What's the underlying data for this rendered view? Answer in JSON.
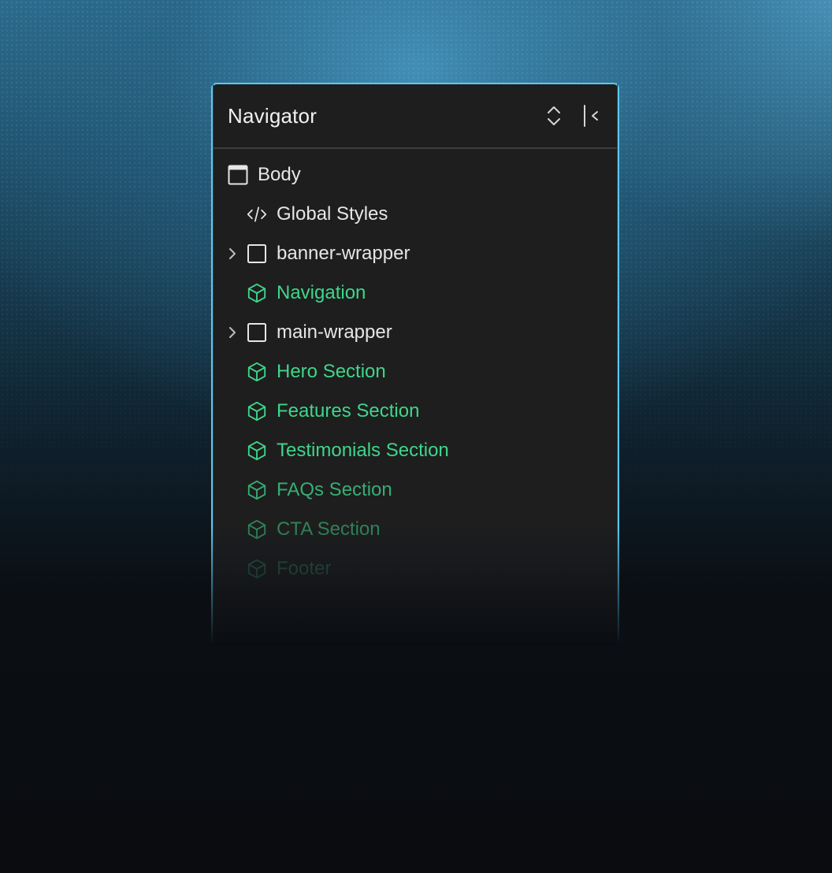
{
  "navigator": {
    "title": "Navigator"
  },
  "tree": {
    "items": [
      {
        "label": "Body",
        "icon": "body-frame-icon",
        "color": "#e6e6e6"
      },
      {
        "label": "Global Styles",
        "icon": "code-icon",
        "color": "#e6e6e6"
      },
      {
        "label": "banner-wrapper",
        "icon": "box-outline-icon",
        "color": "#e6e6e6",
        "expandable": true
      },
      {
        "label": "Navigation",
        "icon": "component-cube-icon",
        "color": "#3fd68a"
      },
      {
        "label": "main-wrapper",
        "icon": "box-outline-icon",
        "color": "#e6e6e6",
        "expandable": true
      },
      {
        "label": "Hero Section",
        "icon": "component-cube-icon",
        "color": "#3fd68a"
      },
      {
        "label": "Features Section",
        "icon": "component-cube-icon",
        "color": "#3fd68a"
      },
      {
        "label": "Testimonials Section",
        "icon": "component-cube-icon",
        "color": "#3fd68a"
      },
      {
        "label": "FAQs Section",
        "icon": "component-cube-icon",
        "color": "#3fd68a"
      },
      {
        "label": "CTA Section",
        "icon": "component-cube-icon",
        "color": "#3fd68a"
      },
      {
        "label": "Footer",
        "icon": "component-cube-icon",
        "color": "#3fd68a"
      }
    ]
  },
  "colors": {
    "accent_green": "#3fd68a",
    "panel_border_glow": "#5cc7ee",
    "panel_bg": "#1e1e1f"
  }
}
